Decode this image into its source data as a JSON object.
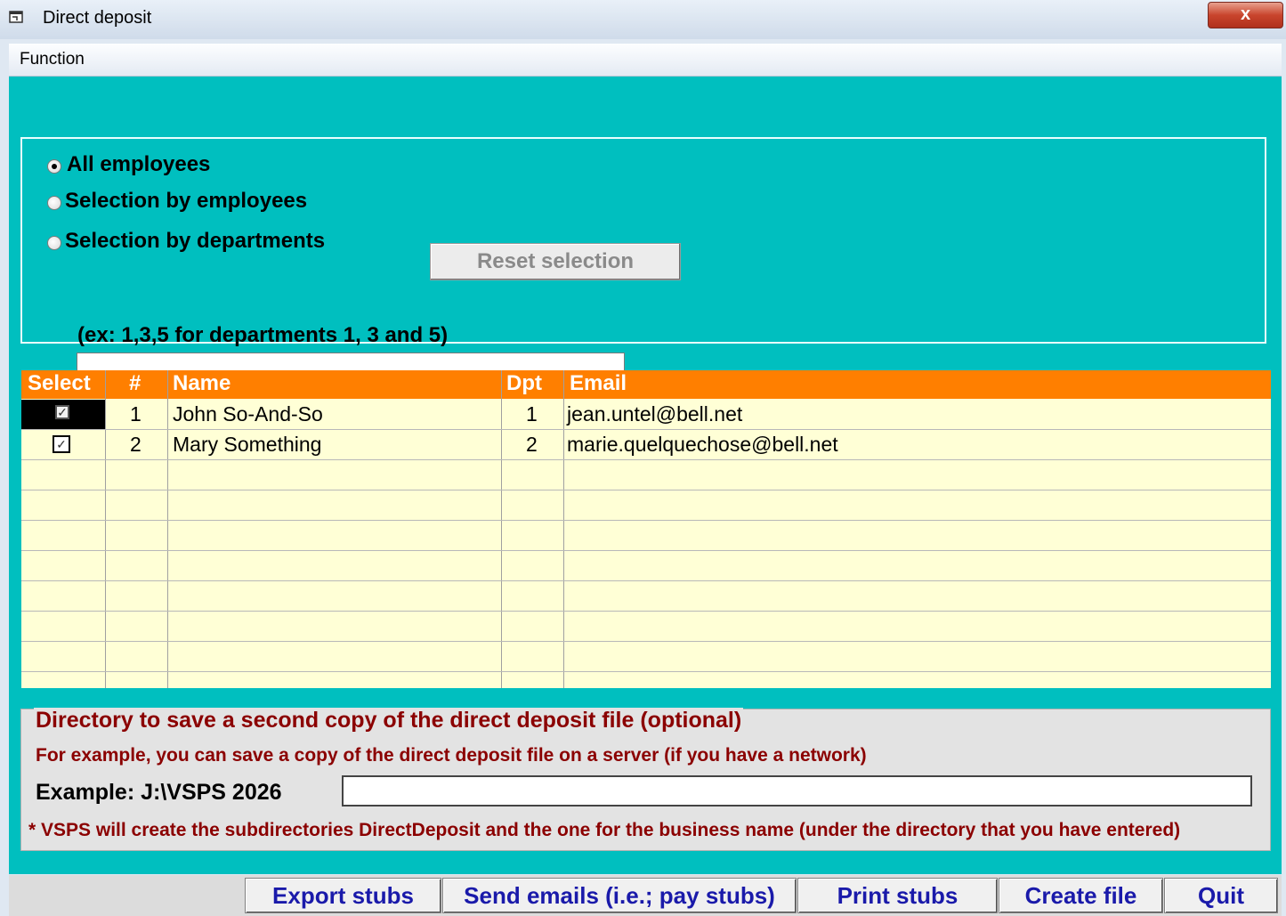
{
  "window": {
    "title": "Direct deposit",
    "close_label": "x"
  },
  "menu": {
    "items": [
      "Function"
    ]
  },
  "options": {
    "all_employees": "All employees",
    "by_employees": "Selection by employees",
    "by_departments": "Selection by departments",
    "selected": "all_employees",
    "reset_label": "Reset selection",
    "dept_hint": "(ex: 1,3,5 for departments 1, 3 and 5)",
    "dept_value": ""
  },
  "grid": {
    "headers": {
      "select": "Select",
      "num": "#",
      "name": "Name",
      "dpt": "Dpt",
      "email": "Email"
    },
    "rows": [
      {
        "selected": true,
        "num": "1",
        "name": "John So-And-So",
        "dpt": "1",
        "email": "jean.untel@bell.net"
      },
      {
        "selected": true,
        "num": "2",
        "name": "Mary Something",
        "dpt": "2",
        "email": "marie.quelquechose@bell.net"
      }
    ]
  },
  "directory": {
    "legend": "Directory to save a second copy of the direct deposit file (optional)",
    "line1": "For example, you can save a copy of the direct deposit file on a server (if you have a network)",
    "example": "Example: J:\\VSPS 2026",
    "value": "",
    "note": "* VSPS will create the subdirectories DirectDeposit and the one for the business name (under the directory that you have entered)"
  },
  "buttons": {
    "export": "Export stubs",
    "send": "Send emails (i.e.; pay stubs)",
    "print": "Print stubs",
    "create": "Create file",
    "quit": "Quit"
  },
  "colors": {
    "client_bg": "#00bfbf",
    "grid_header": "#ff7f00",
    "grid_bg": "#ffffd6",
    "dir_text": "#8b0000",
    "button_text": "#1a1aaa"
  }
}
